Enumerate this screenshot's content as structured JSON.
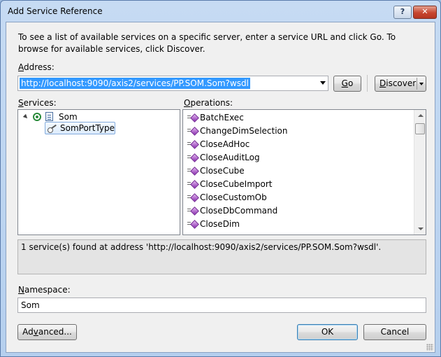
{
  "window": {
    "title": "Add Service Reference",
    "help_button": "?",
    "close_button": "✕"
  },
  "description": "To see a list of available services on a specific server, enter a service URL and click Go. To browse for available services, click Discover.",
  "address": {
    "label_accel": "A",
    "label_rest": "ddress:",
    "value": "http://localhost:9090/axis2/services/PP.SOM.Som?wsdl"
  },
  "buttons": {
    "go_accel": "G",
    "go_rest": "o",
    "discover_accel": "D",
    "discover_rest": "iscover",
    "advanced_pre": "Ad",
    "advanced_accel": "v",
    "advanced_post": "anced...",
    "ok": "OK",
    "cancel": "Cancel"
  },
  "services": {
    "label_accel": "S",
    "label_rest": "ervices:",
    "tree": {
      "root": "Som",
      "child": "SomPortType"
    }
  },
  "operations": {
    "label_accel": "O",
    "label_rest": "perations:",
    "items": [
      "BatchExec",
      "ChangeDimSelection",
      "CloseAdHoc",
      "CloseAuditLog",
      "CloseCube",
      "CloseCubeImport",
      "CloseCustomOb",
      "CloseDbCommand",
      "CloseDim"
    ]
  },
  "status": "1 service(s) found at address 'http://localhost:9090/axis2/services/PP.SOM.Som?wsdl'.",
  "namespace": {
    "label_accel": "N",
    "label_rest": "amespace:",
    "value": "Som"
  }
}
